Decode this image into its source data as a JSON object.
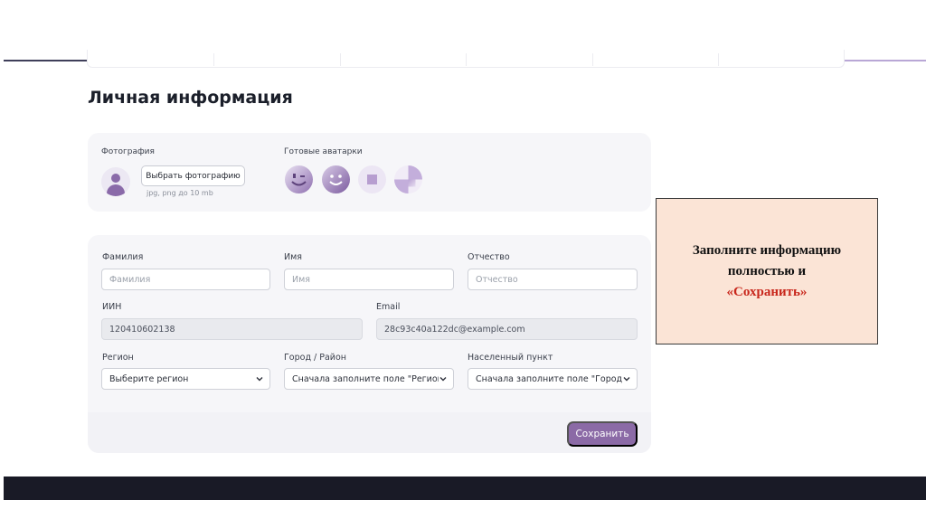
{
  "page": {
    "title": "Личная информация"
  },
  "photo": {
    "label": "Фотография",
    "choose_button": "Выбрать фотографию",
    "hint": "jpg, png до 10 mb",
    "presets_label": "Готовые аватарки",
    "presets": [
      "avatar-wink",
      "avatar-smile",
      "avatar-square",
      "avatar-geometric"
    ]
  },
  "form": {
    "last_name": {
      "label": "Фамилия",
      "placeholder": "Фамилия"
    },
    "first_name": {
      "label": "Имя",
      "placeholder": "Имя"
    },
    "patronymic": {
      "label": "Отчество",
      "placeholder": "Отчество"
    },
    "iin": {
      "label": "ИИН",
      "value": "120410602138"
    },
    "email": {
      "label": "Email",
      "value": "28c93c40a122dc@example.com"
    },
    "region": {
      "label": "Регион",
      "value": "Выберите регион"
    },
    "city": {
      "label": "Город / Район",
      "value": "Сначала заполните поле \"Регион\""
    },
    "settlement": {
      "label": "Населенный пункт",
      "value": "Сначала заполните поле \"Город / Район\""
    },
    "save_button": "Сохранить"
  },
  "callout": {
    "line1": "Заполните информацию",
    "line2": "полностью и",
    "line3": "«Сохранить»"
  },
  "colors": {
    "accent": "#8b6aa6",
    "callout_bg": "#fbe4d6",
    "callout_accent": "#c8261b",
    "bottom_band": "#191a26"
  }
}
